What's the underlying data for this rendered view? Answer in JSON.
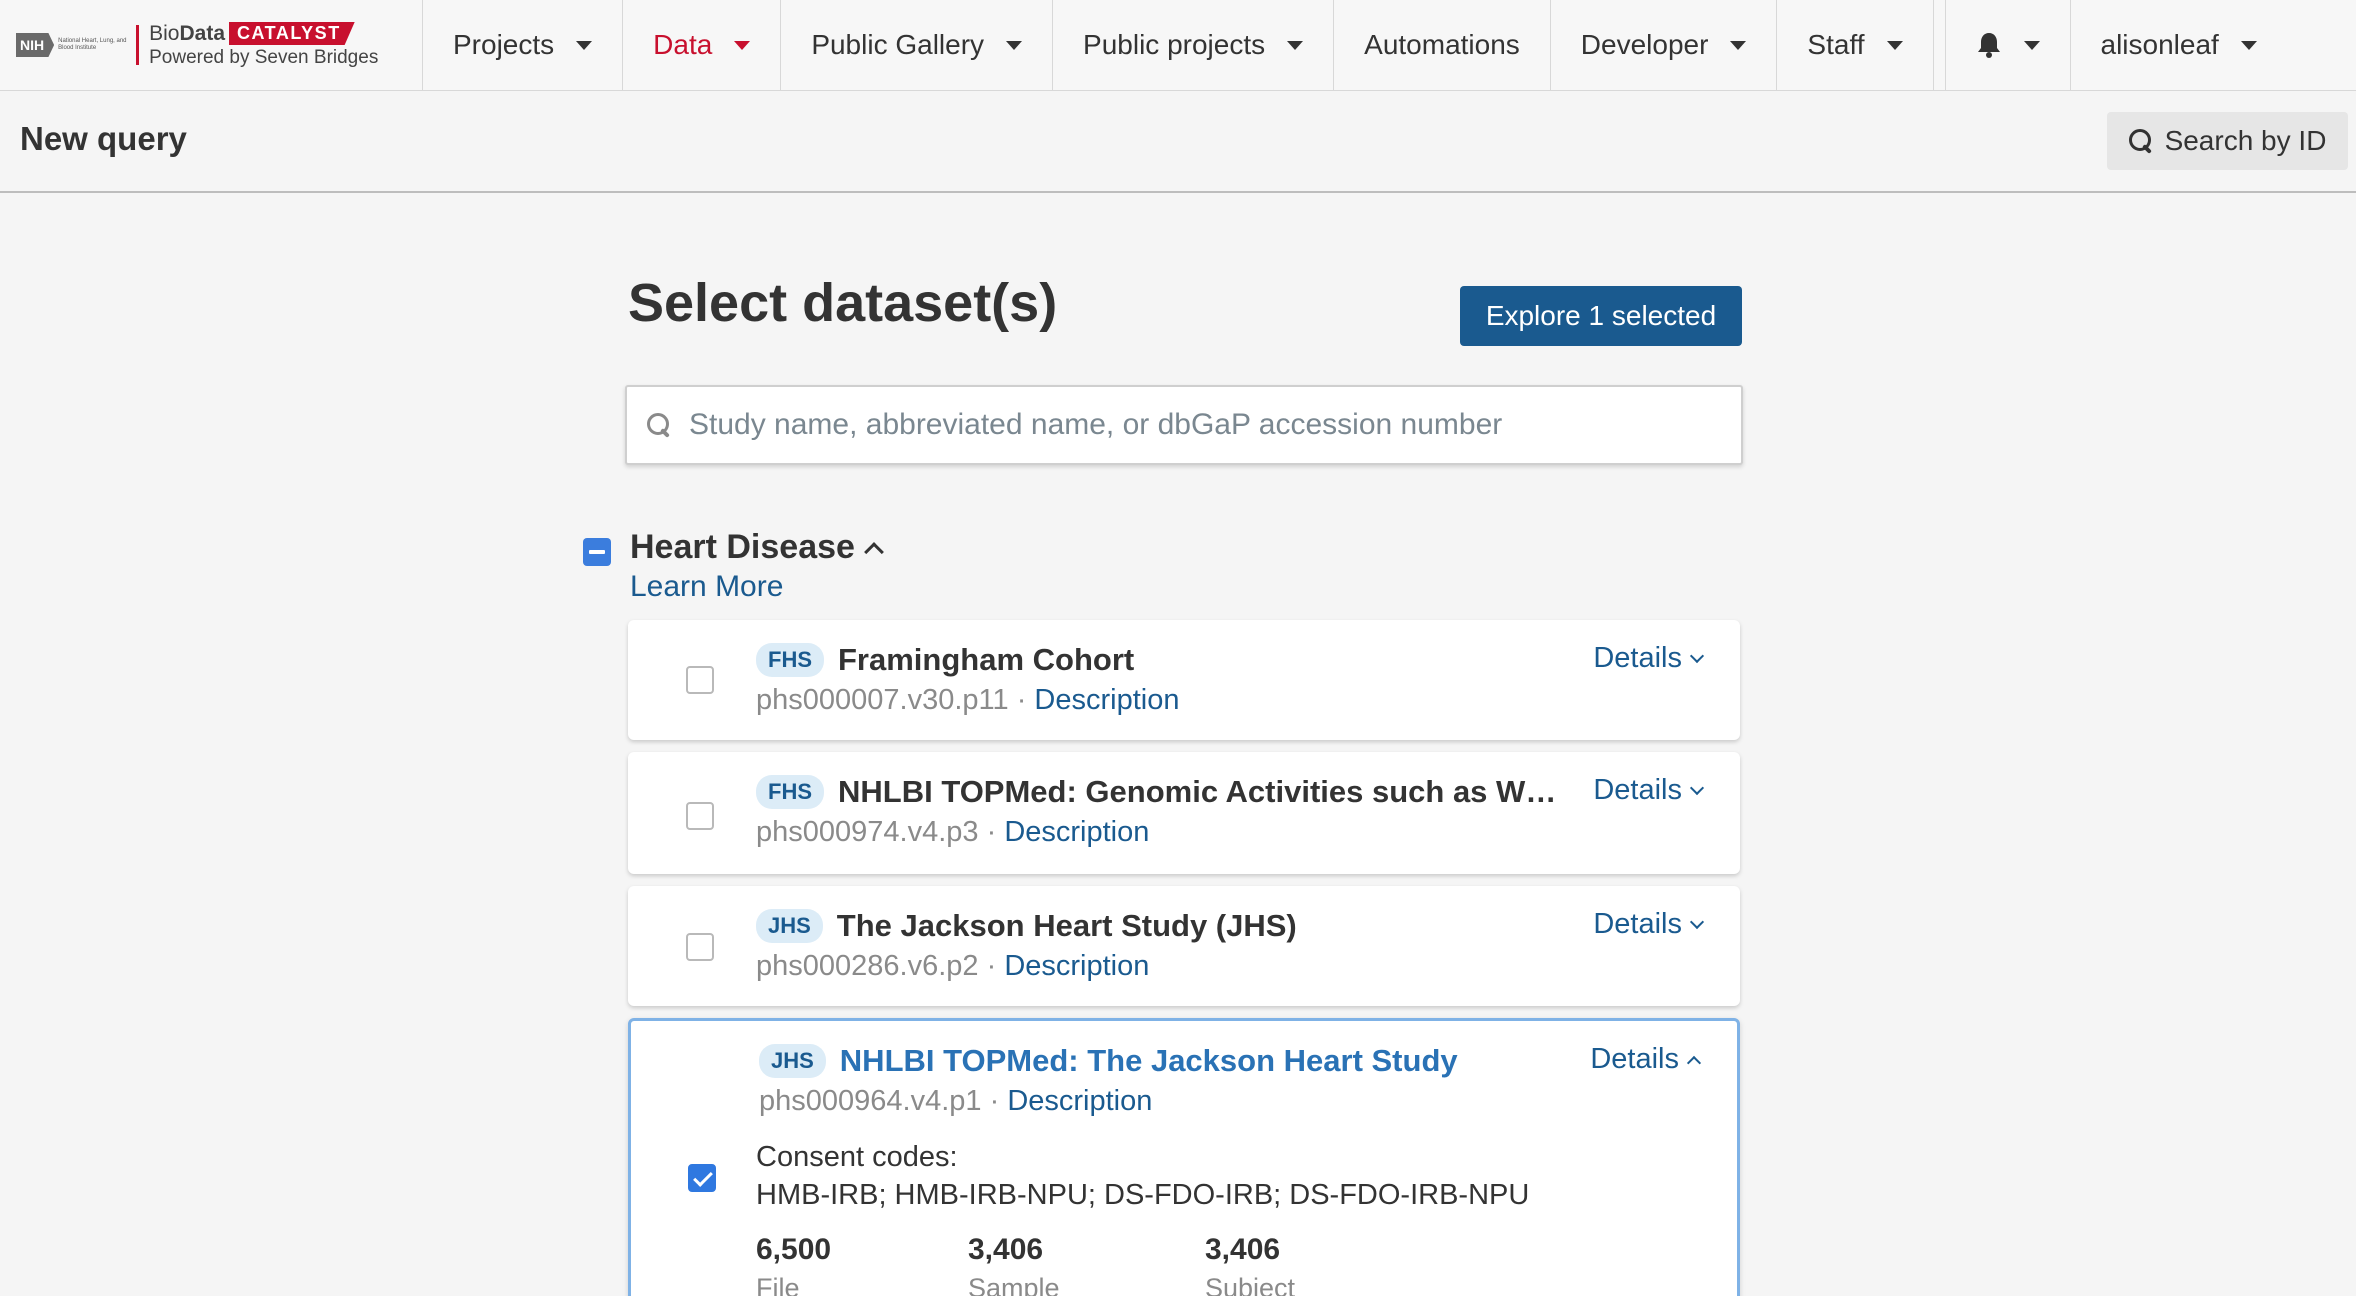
{
  "brand": {
    "nih": "NIH",
    "nih_institute": "National Heart, Lung, and Blood Institute",
    "bio": "Bio",
    "data": "Data",
    "catalyst": "CATALYST",
    "powered": "Powered by Seven Bridges"
  },
  "nav": {
    "items": [
      {
        "label": "Projects",
        "dropdown": true
      },
      {
        "label": "Data",
        "dropdown": true,
        "active": true
      },
      {
        "label": "Public Gallery",
        "dropdown": true
      },
      {
        "label": "Public projects",
        "dropdown": true
      },
      {
        "label": "Automations",
        "dropdown": false
      },
      {
        "label": "Developer",
        "dropdown": true
      },
      {
        "label": "Staff",
        "dropdown": true
      }
    ],
    "user": "alisonleaf",
    "active_color": "#c8102e"
  },
  "subheader": {
    "title": "New query",
    "search_by_id": "Search by ID"
  },
  "main": {
    "title": "Select dataset(s)",
    "explore_button": "Explore 1 selected",
    "search_placeholder": "Study name, abbreviated name, or dbGaP accession number",
    "search_value": "",
    "group": {
      "title": "Heart Disease",
      "learn_more": "Learn More",
      "state": "partial"
    },
    "datasets": [
      {
        "abbr": "FHS",
        "name": "Framingham Cohort",
        "accession": "phs000007.v30.p11",
        "description": "Description",
        "details": "Details",
        "checked": false
      },
      {
        "abbr": "FHS",
        "name": "NHLBI TOPMed: Genomic Activities such as Whole…",
        "accession": "phs000974.v4.p3",
        "description": "Description",
        "details": "Details",
        "checked": false
      },
      {
        "abbr": "JHS",
        "name": "The Jackson Heart Study (JHS)",
        "accession": "phs000286.v6.p2",
        "description": "Description",
        "details": "Details",
        "checked": false
      },
      {
        "abbr": "JHS",
        "name": "NHLBI TOPMed: The Jackson Heart Study",
        "accession": "phs000964.v4.p1",
        "description": "Description",
        "details": "Details",
        "checked": true,
        "expanded": true,
        "consent_label": "Consent codes:",
        "consent_codes": "HMB-IRB; HMB-IRB-NPU; DS-FDO-IRB; DS-FDO-IRB-NPU",
        "stats": [
          {
            "value": "6,500",
            "label": "File"
          },
          {
            "value": "3,406",
            "label": "Sample"
          },
          {
            "value": "3,406",
            "label": "Subject"
          }
        ]
      }
    ],
    "separator": " · "
  },
  "colors": {
    "primary_button": "#1a5a8f",
    "link": "#1a5a8f",
    "checkbox_checked": "#2f78e0",
    "abbr_badge_bg": "#dcecf7",
    "brand_red": "#c8102e"
  },
  "icons": [
    "search-icon",
    "bell-icon",
    "caret-down-icon",
    "chevron-up-icon",
    "chevron-down-icon",
    "checkmark-icon"
  ]
}
